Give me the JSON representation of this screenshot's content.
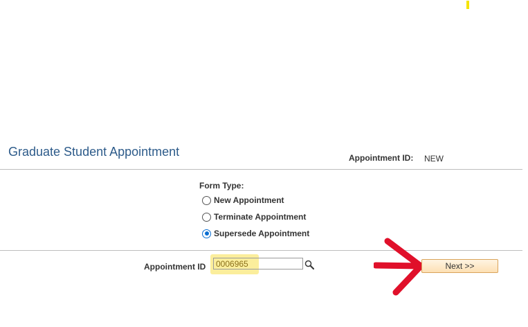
{
  "header": {
    "title": "Graduate Student Appointment",
    "appointment_id_label": "Appointment ID:",
    "appointment_id_value": "NEW"
  },
  "form_type": {
    "label": "Form Type:",
    "options": [
      {
        "label": "New Appointment",
        "checked": false
      },
      {
        "label": "Terminate Appointment",
        "checked": false
      },
      {
        "label": "Supersede Appointment",
        "checked": true
      }
    ]
  },
  "appointment_field": {
    "label": "Appointment ID",
    "value": "0006965"
  },
  "actions": {
    "next_label": "Next >>"
  },
  "colors": {
    "title": "#2d5b8a",
    "highlight": "#fbee9c",
    "arrow": "#e0102a",
    "radio_selected": "#0a6ed1"
  },
  "icons": {
    "lookup": "magnifier-icon",
    "annotation": "red-arrow-icon"
  }
}
